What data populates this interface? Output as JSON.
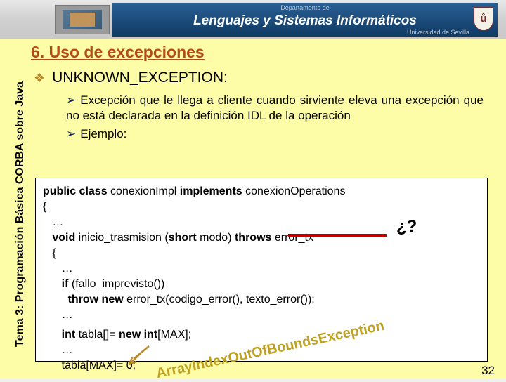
{
  "header": {
    "dept": "Departamento de",
    "main": "Lenguajes y Sistemas Informáticos",
    "uni": "Universidad de Sevilla",
    "shield": "ů"
  },
  "sidebar": "Tema 3: Programación Básica CORBA sobre Java",
  "section_title": "6. Uso de excepciones",
  "bullet1": "UNKNOWN_EXCEPTION:",
  "bullet2a": "Excepción que le llega a cliente cuando sirviente eleva una excepción que no está declarada en la definición IDL de la operación",
  "bullet2b": "Ejemplo:",
  "code": {
    "l1a": "public class",
    "l1b": " conexionImpl ",
    "l1c": "implements",
    "l1d": " conexionOperations",
    "l2": "{",
    "l3": "   …",
    "l4a": "   void",
    "l4b": " inicio_trasmision (",
    "l4c": "short",
    "l4d": " modo) ",
    "l4e": "throws",
    "l4f": " error_tx",
    "l5": "   {",
    "l6": "      …",
    "l7a": "      if ",
    "l7b": "(fallo_imprevisto())",
    "l8a": "        throw new",
    "l8b": " error_tx(codigo_error(), texto_error());",
    "l9": "      …",
    "l10a": "      int",
    "l10b": " tabla[]= ",
    "l10c": "new int",
    "l10d": "[MAX];",
    "l11": "      …",
    "l12": "      tabla[MAX]= 0;"
  },
  "qmark": "¿?",
  "exception1": "ArrayIndexOutOfBoundsException",
  "page": "32"
}
